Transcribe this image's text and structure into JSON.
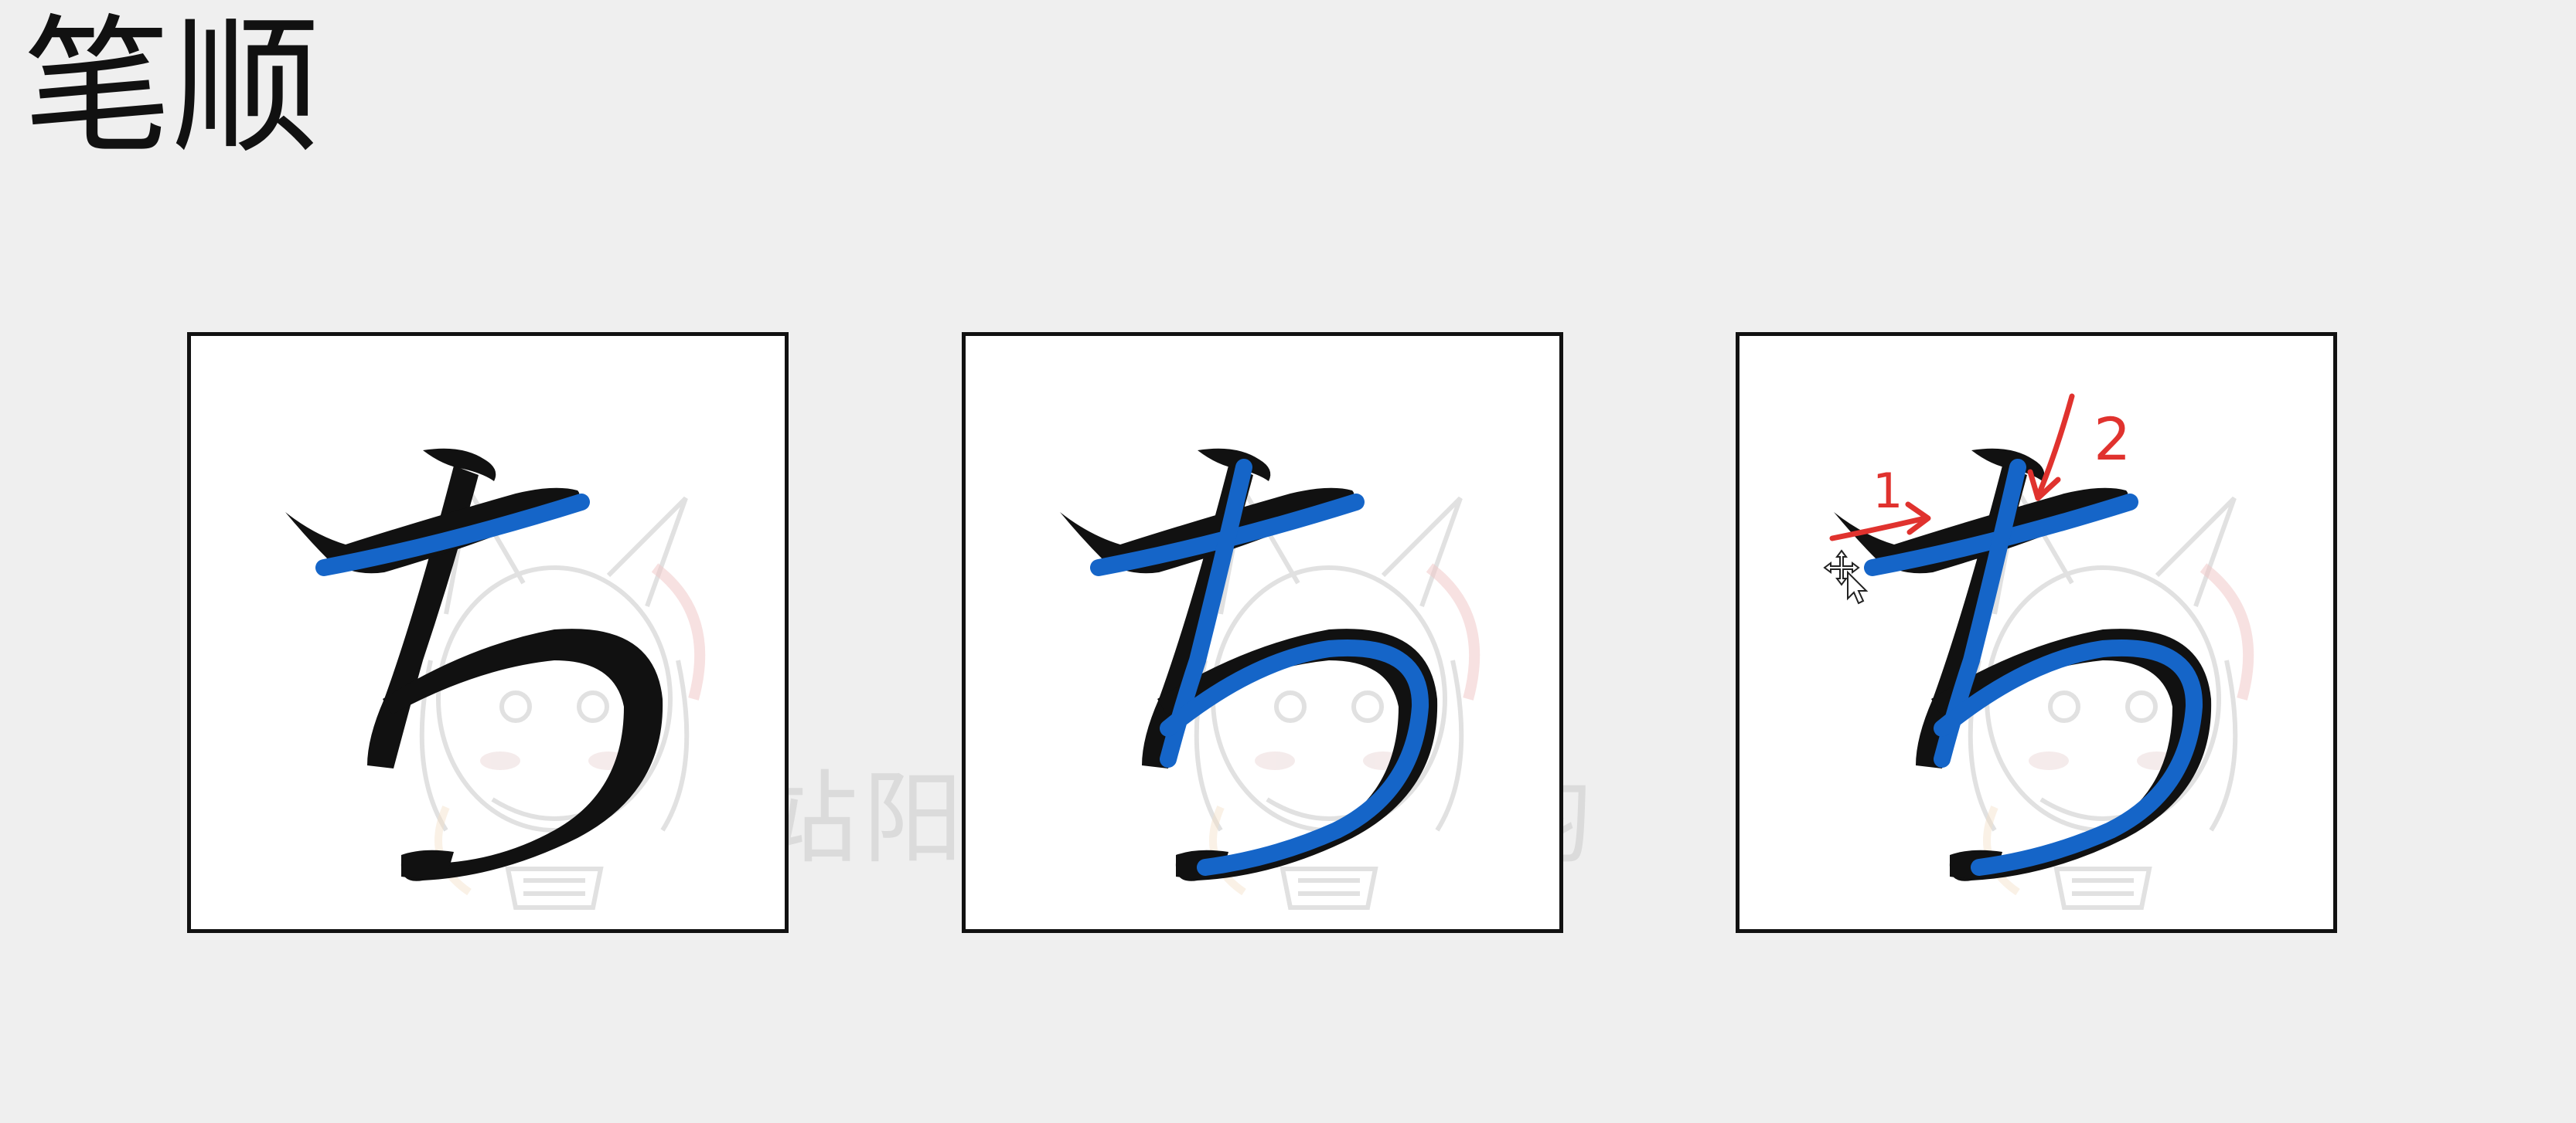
{
  "title": "笔顺",
  "panels": [
    {
      "kana": "ち",
      "highlighted_strokes": 1
    },
    {
      "kana": "ち",
      "highlighted_strokes": 2
    },
    {
      "kana": "ち",
      "highlighted_strokes": 2,
      "annotations": [
        "1",
        "2"
      ]
    }
  ],
  "watermark": {
    "words": [
      "站阳",
      "均"
    ]
  },
  "colors": {
    "background": "#efefef",
    "panel_bg": "#ffffff",
    "stroke_black": "#111111",
    "stroke_blue": "#1565c8",
    "annotation_red": "#e0322e"
  },
  "icons": [
    "move-cursor-icon",
    "arrow-right-icon",
    "arrow-down-icon"
  ]
}
